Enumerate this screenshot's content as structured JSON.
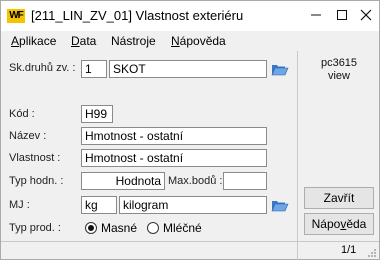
{
  "window": {
    "logo": "WF",
    "title": "[211_LIN_ZV_01] Vlastnost exteriéru"
  },
  "menu": {
    "items": [
      {
        "pre": "",
        "key": "A",
        "post": "plikace"
      },
      {
        "pre": "",
        "key": "D",
        "post": "ata"
      },
      {
        "pre": "Nástro",
        "key": "j",
        "post": "e"
      },
      {
        "pre": "",
        "key": "N",
        "post": "ápověda"
      }
    ]
  },
  "form": {
    "sk_druhu_label": "Sk.druhů zv. :",
    "sk_druhu_code": "1",
    "sk_druhu_name": "SKOT",
    "kod_label": "Kód :",
    "kod_value": "H99",
    "nazev_label": "Název :",
    "nazev_value": "Hmotnost - ostatní",
    "vlastnost_label": "Vlastnost :",
    "vlastnost_value": "Hmotnost - ostatní",
    "typ_hodn_label": "Typ hodn. :",
    "typ_hodn_value": "Hodnota",
    "max_bodu_label": "Max.bodů :",
    "max_bodu_value": "",
    "mj_label": "MJ :",
    "mj_code": "kg",
    "mj_name": "kilogram",
    "typ_prod_label": "Typ prod. :",
    "typ_prod_options": [
      {
        "label": "Masné",
        "checked": true
      },
      {
        "label": "Mléčné",
        "checked": false
      }
    ]
  },
  "side": {
    "info_line1": "pc3615",
    "info_line2": "view",
    "close_pre": "Zavřít",
    "help_pre": "Nápo",
    "help_key": "v",
    "help_post": "ěda"
  },
  "status": {
    "page": "1/1"
  }
}
